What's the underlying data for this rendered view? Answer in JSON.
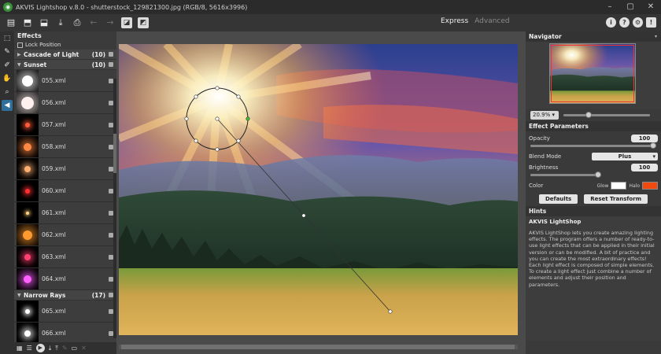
{
  "window": {
    "title": "AKVIS Lightshop v.8.0 - shutterstock_129821300.jpg (RGB/8, 5616x3996)",
    "controls": [
      "–",
      "▢",
      "✕"
    ]
  },
  "toolbar": {
    "mode_express": "Express",
    "mode_advanced": "Advanced",
    "right_icons": [
      "i",
      "?",
      "⚙",
      "!"
    ]
  },
  "effects": {
    "header": "Effects",
    "lock_position": "Lock Position",
    "groups": [
      {
        "name": "Cascade of Light",
        "count": "(10)",
        "expanded": false
      },
      {
        "name": "Sunset",
        "count": "(10)",
        "expanded": true
      },
      {
        "name": "Narrow Rays",
        "count": "(17)",
        "expanded": true
      }
    ],
    "sunset_items": [
      "055.xml",
      "056.xml",
      "057.xml",
      "058.xml",
      "059.xml",
      "060.xml",
      "061.xml",
      "062.xml",
      "063.xml",
      "064.xml"
    ],
    "narrow_items": [
      "065.xml",
      "066.xml"
    ]
  },
  "navigator": {
    "header": "Navigator",
    "zoom": "20.9%"
  },
  "params": {
    "header": "Effect Parameters",
    "opacity_label": "Opacity",
    "opacity_value": "100",
    "opacity_level": 1.0,
    "blend_label": "Blend Mode",
    "blend_value": "Plus",
    "brightness_label": "Brightness",
    "brightness_value": "100",
    "color_label": "Color",
    "glow_label": "Glow",
    "halo_label": "Halo",
    "glow_color": "#ffffff",
    "halo_color": "#f04a10",
    "defaults_button": "Defaults",
    "reset_button": "Reset Transform"
  },
  "hints": {
    "header": "Hints",
    "title": "AKVIS LightShop",
    "p1": "AKVIS LightShop lets you create amazing lighting effects. The program offers a number of ready-to-use light effects that can be applied in their initial version or can be modified. A bit of practice and you can create the most extraordinary effects!",
    "p2": "Each light effect is composed of simple elements. To create a light effect just combine a number of elements and adjust their position and parameters."
  }
}
